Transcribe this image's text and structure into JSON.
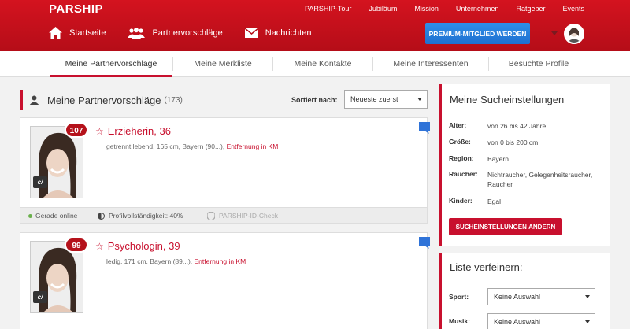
{
  "header": {
    "logo": "PARSHIP",
    "topnav": [
      "PARSHIP-Tour",
      "Jubiläum",
      "Mission",
      "Unternehmen",
      "Ratgeber",
      "Events"
    ],
    "mainnav": {
      "home": "Startseite",
      "matches": "Partnervorschläge",
      "messages": "Nachrichten"
    },
    "premium_label": "PREMIUM-MITGLIED WERDEN"
  },
  "subnav": {
    "tabs": [
      "Meine Partnervorschläge",
      "Meine Merkliste",
      "Meine Kontakte",
      "Meine Interessenten",
      "Besuchte Profile"
    ]
  },
  "matches": {
    "title": "Meine Partnervorschläge",
    "count": "(173)",
    "sort_label": "Sortiert nach:",
    "sort_value": "Neueste zuerst",
    "cards": [
      {
        "score": "107",
        "name": "Erzieherin, 36",
        "details": "getrennt lebend, 165 cm, Bayern (90...), ",
        "distance": "Entfernung in KM",
        "status": "Gerade online",
        "profile": "Profilvollständigkeit: 40%",
        "idcheck": "PARSHIP-ID-Check"
      },
      {
        "score": "99",
        "name": "Psychologin, 39",
        "details": "ledig, 171 cm, Bayern (89...), ",
        "distance": "Entfernung in KM"
      }
    ]
  },
  "search_settings": {
    "title": "Meine Sucheinstellungen",
    "criteria": [
      {
        "key": "Alter:",
        "value": "von 26 bis 42 Jahre"
      },
      {
        "key": "Größe:",
        "value": "von 0 bis 200 cm"
      },
      {
        "key": "Region:",
        "value": "Bayern"
      },
      {
        "key": "Raucher:",
        "value": "Nichtraucher, Gelegenheitsraucher, Raucher"
      },
      {
        "key": "Kinder:",
        "value": "Egal"
      }
    ],
    "change_button": "SUCHEINSTELLUNGEN ÄNDERN"
  },
  "refine": {
    "title": "Liste verfeinern:",
    "filters": [
      {
        "label": "Sport:",
        "value": "Keine Auswahl"
      },
      {
        "label": "Musik:",
        "value": "Keine Auswahl"
      }
    ]
  },
  "colors": {
    "brand_red": "#c8102e",
    "premium_blue": "#2f8fe8"
  }
}
